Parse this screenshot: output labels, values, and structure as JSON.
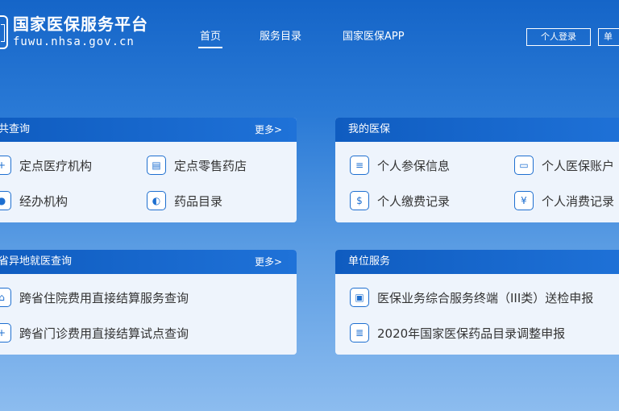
{
  "header": {
    "title": "国家医保服务平台",
    "url": "fuwu.nhsa.gov.cn",
    "nav": [
      {
        "label": "首页",
        "active": true
      },
      {
        "label": "服务目录",
        "active": false
      },
      {
        "label": "国家医保APP",
        "active": false
      }
    ],
    "login_label": "个人登录",
    "login2_label": "单"
  },
  "panels": {
    "public": {
      "title": "共查询",
      "more": "更多>",
      "items": [
        {
          "label": "定点医疗机构",
          "icon": "hospital-icon"
        },
        {
          "label": "定点零售药店",
          "icon": "store-icon"
        },
        {
          "label": "经办机构",
          "icon": "location-icon"
        },
        {
          "label": "药品目录",
          "icon": "pill-icon"
        }
      ]
    },
    "mine": {
      "title": "我的医保",
      "items": [
        {
          "label": "个人参保信息",
          "icon": "document-icon"
        },
        {
          "label": "个人医保账户",
          "icon": "wallet-icon"
        },
        {
          "label": "个人缴费记录",
          "icon": "payment-icon"
        },
        {
          "label": "个人消费记录",
          "icon": "yuan-icon"
        }
      ]
    },
    "crossprov": {
      "title": "省异地就医查询",
      "more": "更多>",
      "items": [
        {
          "label": "跨省住院费用直接结算服务查询",
          "icon": "hospital-stay-icon"
        },
        {
          "label": "跨省门诊费用直接结算试点查询",
          "icon": "outpatient-icon"
        }
      ]
    },
    "unit": {
      "title": "单位服务",
      "items": [
        {
          "label": "医保业务综合服务终端（III类）送检申报",
          "icon": "terminal-icon"
        },
        {
          "label": "2020年国家医保药品目录调整申报",
          "icon": "report-icon"
        }
      ]
    }
  }
}
